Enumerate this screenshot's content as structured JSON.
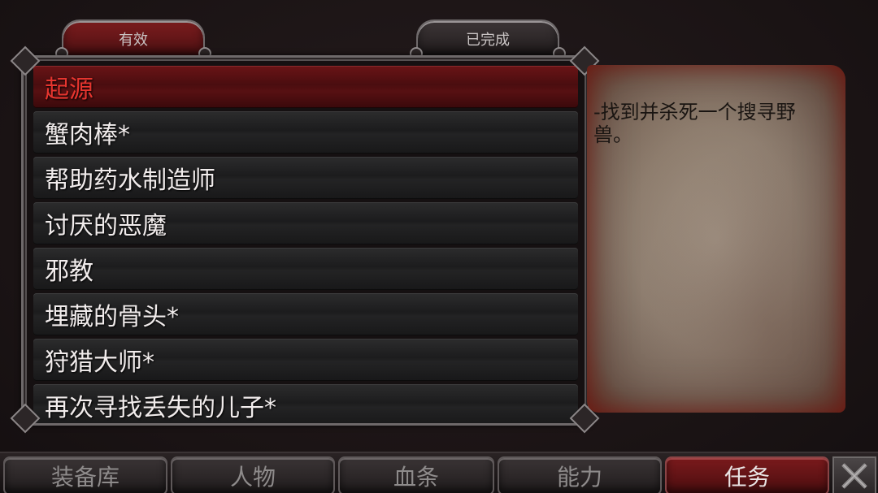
{
  "tabs": {
    "active": "有效",
    "completed": "已完成"
  },
  "quests": [
    "起源",
    "蟹肉棒*",
    "帮助药水制造师",
    "讨厌的恶魔",
    "邪教",
    "埋藏的骨头*",
    "狩猎大师*",
    "再次寻找丢失的儿子*"
  ],
  "selected_quest_index": 0,
  "description": "-找到并杀死一个搜寻野兽。",
  "nav": {
    "inventory": "装备库",
    "character": "人物",
    "health_bar": "血条",
    "abilities": "能力",
    "quests": "任务"
  },
  "colors": {
    "selected_text": "#e6352f",
    "accent_red": "#7a1a1c"
  },
  "icons": {
    "close": "close-x-icon"
  }
}
